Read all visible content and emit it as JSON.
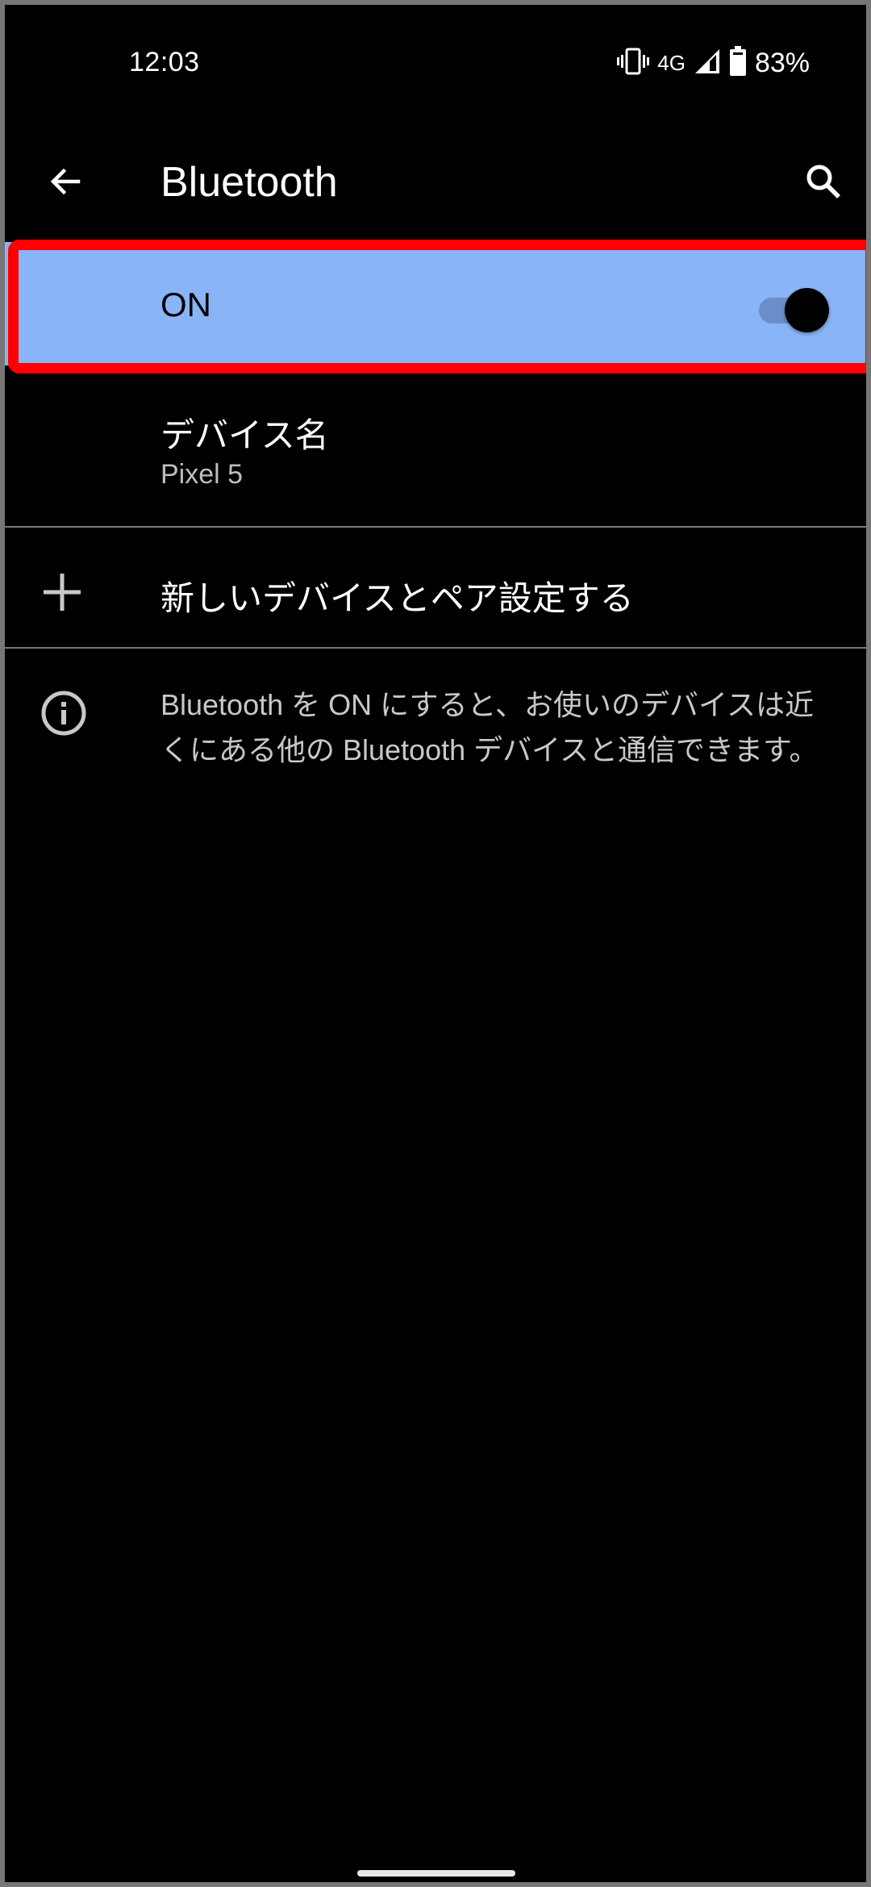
{
  "status_bar": {
    "time": "12:03",
    "icons": [
      "vibrate-icon",
      "signal-icon",
      "battery-icon"
    ],
    "network": "4G",
    "battery_percent": "83%"
  },
  "app_bar": {
    "title": "Bluetooth",
    "back_icon": "arrow-back-icon",
    "search_icon": "search-icon"
  },
  "master_switch": {
    "label": "ON",
    "checked": true,
    "highlight_color": "#ff0000",
    "background_color": "#8ab4f8"
  },
  "device_name": {
    "title": "デバイス名",
    "value": "Pixel 5"
  },
  "pair_new": {
    "icon": "plus-icon",
    "label": "新しいデバイスとペア設定する"
  },
  "info": {
    "icon": "info-icon",
    "text": "Bluetooth を ON にすると、お使いのデバイスは近くにある他の Bluetooth デバイスと通信できます。"
  }
}
